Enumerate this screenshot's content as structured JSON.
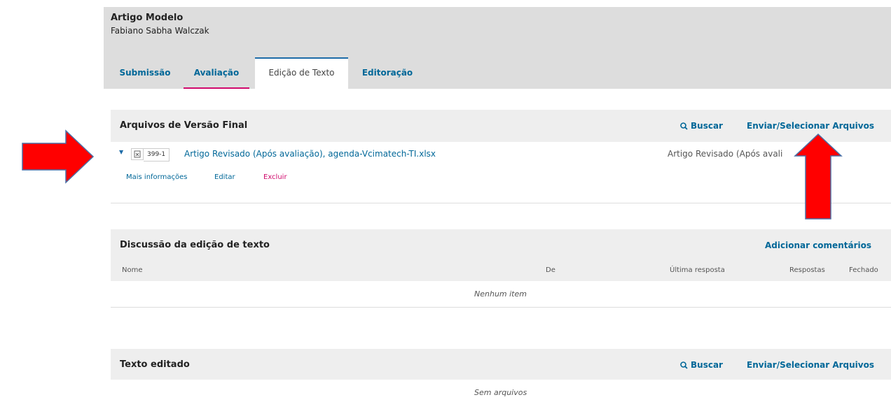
{
  "header": {
    "title": "Artigo Modelo",
    "author": "Fabiano Sabha Walczak"
  },
  "tabs": [
    {
      "label": "Submissão"
    },
    {
      "label": "Avaliação"
    },
    {
      "label": "Edição de Texto"
    },
    {
      "label": "Editoração"
    }
  ],
  "final_files": {
    "title": "Arquivos de Versão Final",
    "search_label": "Buscar",
    "upload_label": "Enviar/Selecionar Arquivos",
    "file": {
      "id": "399-1",
      "name": "Artigo Revisado (Após avaliação), agenda-Vcimatech-TI.xlsx",
      "type_label": "Artigo Revisado (Após avali",
      "actions": {
        "more_info": "Mais informações",
        "edit": "Editar",
        "delete": "Excluir"
      }
    }
  },
  "discussion": {
    "title": "Discussão da edição de texto",
    "add_label": "Adicionar comentários",
    "columns": [
      "Nome",
      "De",
      "Última resposta",
      "Respostas",
      "Fechado"
    ],
    "empty_text": "Nenhum item"
  },
  "edited_text": {
    "title": "Texto editado",
    "search_label": "Buscar",
    "upload_label": "Enviar/Selecionar Arquivos",
    "empty_text": "Sem arquivos"
  },
  "colors": {
    "link": "#006798",
    "delete": "#d00a6c",
    "arrow_fill": "#ff0000",
    "arrow_stroke": "#4a6fa5"
  }
}
